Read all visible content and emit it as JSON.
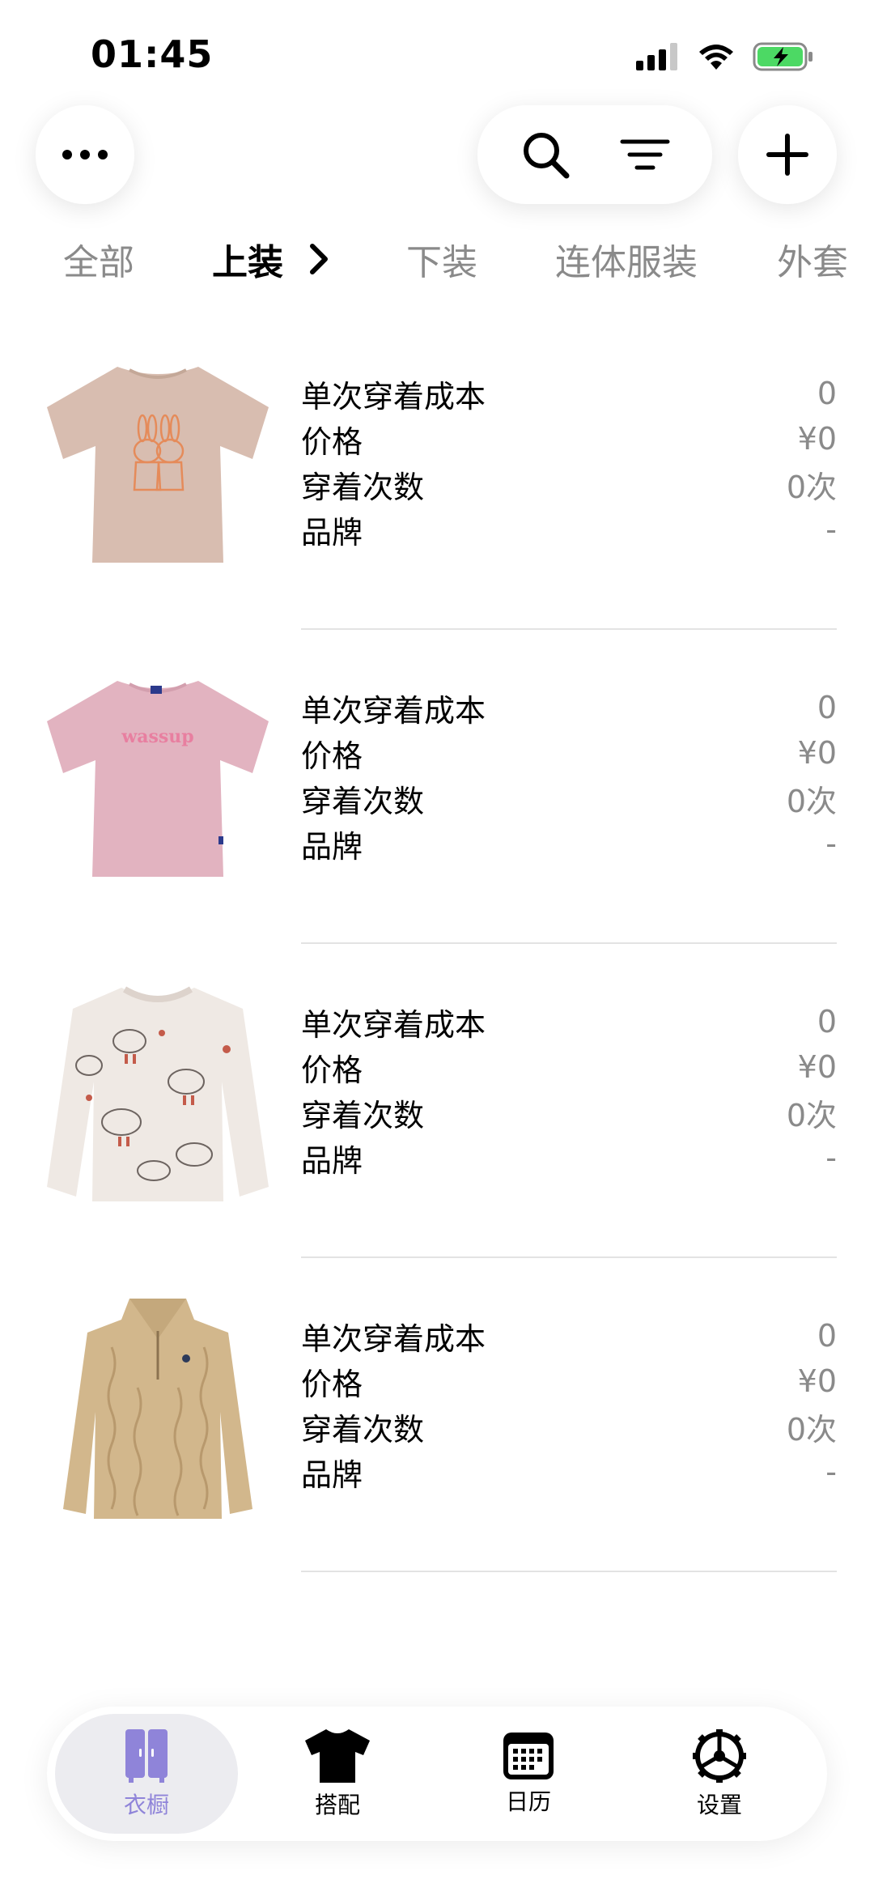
{
  "status_bar": {
    "time": "01:45"
  },
  "tabs": [
    {
      "label": "全部",
      "active": false
    },
    {
      "label": "上装",
      "active": true
    },
    {
      "label": "下装",
      "active": false
    },
    {
      "label": "连体服装",
      "active": false
    },
    {
      "label": "外套",
      "active": false
    }
  ],
  "labels": {
    "cost_per_wear": "单次穿着成本",
    "price": "价格",
    "wear_count": "穿着次数",
    "brand": "品牌"
  },
  "items": [
    {
      "image": "beige-tshirt-bunny-print",
      "cost_per_wear": "0",
      "price": "¥0",
      "wear_count": "0次",
      "brand": "-"
    },
    {
      "image": "pink-tshirt-wassup",
      "wassup_text": "wassup",
      "cost_per_wear": "0",
      "price": "¥0",
      "wear_count": "0次",
      "brand": "-"
    },
    {
      "image": "white-sweater-duck-print",
      "cost_per_wear": "0",
      "price": "¥0",
      "wear_count": "0次",
      "brand": "-"
    },
    {
      "image": "tan-cable-knit-quarter-zip",
      "cost_per_wear": "0",
      "price": "¥0",
      "wear_count": "0次",
      "brand": "-"
    }
  ],
  "bottom_nav": [
    {
      "label": "衣橱",
      "icon": "wardrobe-icon",
      "active": true
    },
    {
      "label": "搭配",
      "icon": "tshirt-icon",
      "active": false
    },
    {
      "label": "日历",
      "icon": "calendar-icon",
      "active": false
    },
    {
      "label": "设置",
      "icon": "settings-gear-icon",
      "active": false
    }
  ],
  "colors": {
    "accent": "#8f84d9",
    "muted_text": "#8a8a8a",
    "battery_green": "#4cd964"
  }
}
